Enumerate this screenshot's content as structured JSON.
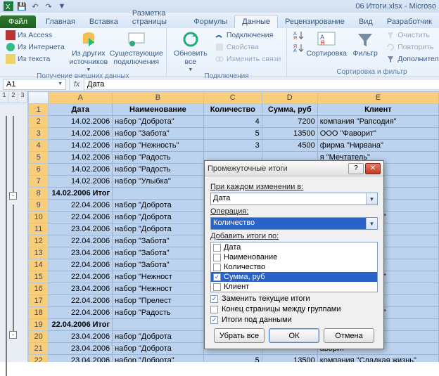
{
  "qat": {
    "save": "💾",
    "undo": "↶",
    "redo": "↷"
  },
  "window_title": "06 Итоги.xlsx - Microso",
  "tabs": {
    "file": "Файл",
    "items": [
      "Главная",
      "Вставка",
      "Разметка страницы",
      "Формулы",
      "Данные",
      "Рецензирование",
      "Вид",
      "Разработчик"
    ],
    "active_index": 4
  },
  "ribbon": {
    "group1": {
      "label": "Получение внешних данных",
      "access": "Из Access",
      "web": "Из Интернета",
      "text": "Из текста",
      "other": "Из других источников",
      "existing": "Существующие подключения"
    },
    "group2": {
      "label": "Подключения",
      "refresh": "Обновить все",
      "conns": "Подключения",
      "props": "Свойства",
      "links": "Изменить связи"
    },
    "group3": {
      "label": "Сортировка и фильтр",
      "az": "А↓Я",
      "za": "Я↓А",
      "sort": "Сортировка",
      "filter": "Фильтр",
      "clear": "Очистить",
      "reapply": "Повторить",
      "advanced": "Дополнительно"
    }
  },
  "namebox": "A1",
  "formula": "Дата",
  "outline_levels": [
    "1",
    "2",
    "3"
  ],
  "columns": [
    "A",
    "B",
    "C",
    "D",
    "E"
  ],
  "headers": [
    "Дата",
    "Наименование",
    "Количество",
    "Сумма, руб",
    "Клиент"
  ],
  "rows": [
    {
      "n": 2,
      "d": "14.02.2006",
      "name": "набор \"Доброта\"",
      "q": "4",
      "s": "7200",
      "c": "компания \"Рапсодия\""
    },
    {
      "n": 3,
      "d": "14.02.2006",
      "name": "набор \"Забота\"",
      "q": "5",
      "s": "13500",
      "c": "ООО \"Фаворит\""
    },
    {
      "n": 4,
      "d": "14.02.2006",
      "name": "набор \"Нежность\"",
      "q": "3",
      "s": "4500",
      "c": "фирма \"Нирвана\""
    },
    {
      "n": 5,
      "d": "14.02.2006",
      "name": "набор \"Радость",
      "q": "",
      "s": "",
      "c": "я \"Мечтатель\""
    },
    {
      "n": 6,
      "d": "14.02.2006",
      "name": "набор \"Радость",
      "q": "",
      "s": "",
      "c": "частливы вместе\""
    },
    {
      "n": 7,
      "d": "14.02.2006",
      "name": "набор \"Улыбка\"",
      "q": "",
      "s": "",
      "c": "олодец\""
    },
    {
      "n": 8,
      "d": "14.02.2006 Итог",
      "name": "",
      "q": "",
      "s": "",
      "c": "",
      "bold": true
    },
    {
      "n": 9,
      "d": "22.04.2006",
      "name": "набор \"Доброта",
      "q": "",
      "s": "",
      "c": "я \"Мечтатель\""
    },
    {
      "n": 10,
      "d": "22.04.2006",
      "name": "набор \"Доброта",
      "q": "",
      "s": "",
      "c": "я \"Сладкая жизнь\""
    },
    {
      "n": 11,
      "d": "23.04.2006",
      "name": "набор \"Доброта",
      "q": "",
      "s": "",
      "c": "частливы вместе\""
    },
    {
      "n": 12,
      "d": "22.04.2006",
      "name": "набор \"Забота\"",
      "q": "",
      "s": "",
      "c": "Нирвана\""
    },
    {
      "n": 13,
      "d": "23.04.2006",
      "name": "набор \"Забота\"",
      "q": "",
      "s": "",
      "c": "я \"Мечтатель\""
    },
    {
      "n": 14,
      "d": "22.04.2006",
      "name": "набор \"Забота\"",
      "q": "",
      "s": "",
      "c": "я \"Рапсодия\""
    },
    {
      "n": 15,
      "d": "22.04.2006",
      "name": "набор \"Нежност",
      "q": "",
      "s": "",
      "c": "я \"Сладкая жизнь\""
    },
    {
      "n": 16,
      "d": "23.04.2006",
      "name": "набор \"Нежност",
      "q": "",
      "s": "",
      "c": "частливы вместе\""
    },
    {
      "n": 17,
      "d": "22.04.2006",
      "name": "набор \"Прелест",
      "q": "",
      "s": "",
      "c": "\"Франкония\""
    },
    {
      "n": 18,
      "d": "22.04.2006",
      "name": "набор \"Радость",
      "q": "",
      "s": "",
      "c": "я \"Сладкая жизнь\""
    },
    {
      "n": 19,
      "d": "22.04.2006 Итог",
      "name": "",
      "q": "",
      "s": "",
      "c": "",
      "bold": true
    },
    {
      "n": 20,
      "d": "23.04.2006",
      "name": "набор \"Доброта",
      "q": "",
      "s": "",
      "c": "олодец\""
    },
    {
      "n": 21,
      "d": "23.04.2006",
      "name": "набор \"Доброта",
      "q": "",
      "s": "",
      "c": "аворит\""
    },
    {
      "n": 22,
      "d": "23.04.2006",
      "name": "набор \"Доброта\"",
      "q": "5",
      "s": "13500",
      "c": "компания \"Сладкая жизнь\""
    }
  ],
  "dialog": {
    "title": "Промежуточные итоги",
    "lbl_change": "При каждом изменении в:",
    "combo_change": "Дата",
    "lbl_op": "Операция:",
    "combo_op": "Количество",
    "lbl_add": "Добавить итоги по:",
    "fields": [
      {
        "label": "Дата",
        "checked": false
      },
      {
        "label": "Наименование",
        "checked": false
      },
      {
        "label": "Количество",
        "checked": false
      },
      {
        "label": "Сумма, руб",
        "checked": true,
        "sel": true
      },
      {
        "label": "Клиент",
        "checked": false
      }
    ],
    "opt_replace": "Заменить текущие итоги",
    "opt_pagebreak": "Конец страницы между группами",
    "opt_below": "Итоги под данными",
    "btn_removeall": "Убрать все",
    "btn_ok": "ОК",
    "btn_cancel": "Отмена"
  }
}
